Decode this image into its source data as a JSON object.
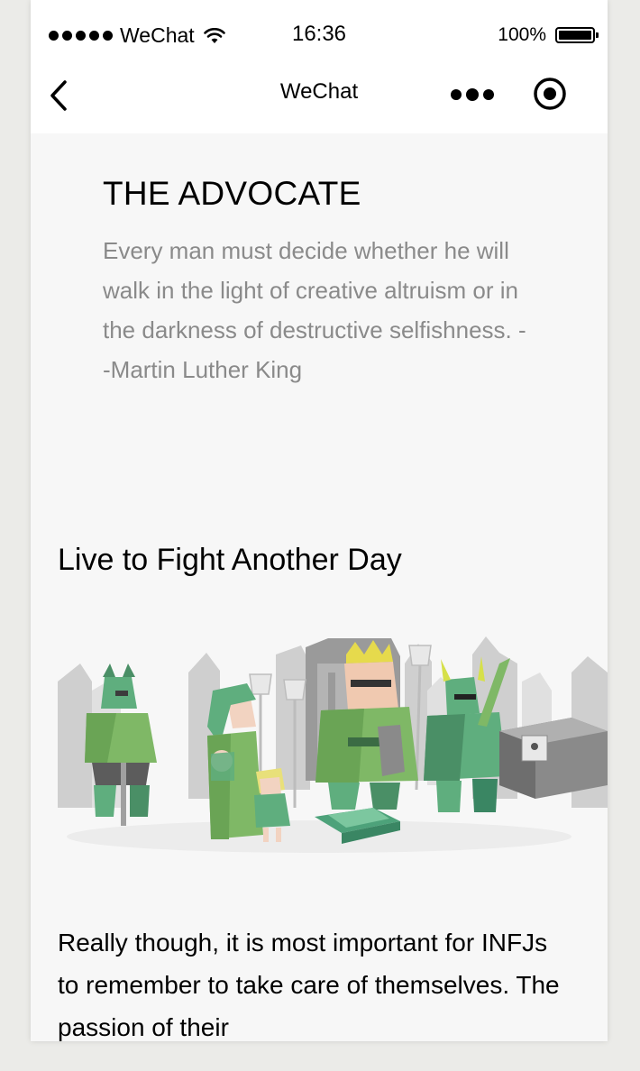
{
  "status_bar": {
    "signal_dots": 5,
    "carrier": "WeChat",
    "time": "16:36",
    "battery_percent": "100%"
  },
  "nav": {
    "title": "WeChat",
    "back_icon": "chevron-left-icon",
    "more_icon": "ellipsis-icon",
    "close_icon": "target-circle-icon"
  },
  "article": {
    "title": "THE ADVOCATE",
    "quote": "Every man must decide whether he will walk in the light of creative altruism or in the darkness of destructive selfishness. --Martin Luther King",
    "section_heading": "Live to Fight Another Day",
    "body": "Really though, it is most important for INFJs to remember to take care of themselves. The passion of their"
  },
  "colors": {
    "background": "#f7f7f7",
    "quote_text": "#8a8a8a",
    "illustration_green": "#5fae7e",
    "illustration_gray": "#c8c8c8"
  }
}
